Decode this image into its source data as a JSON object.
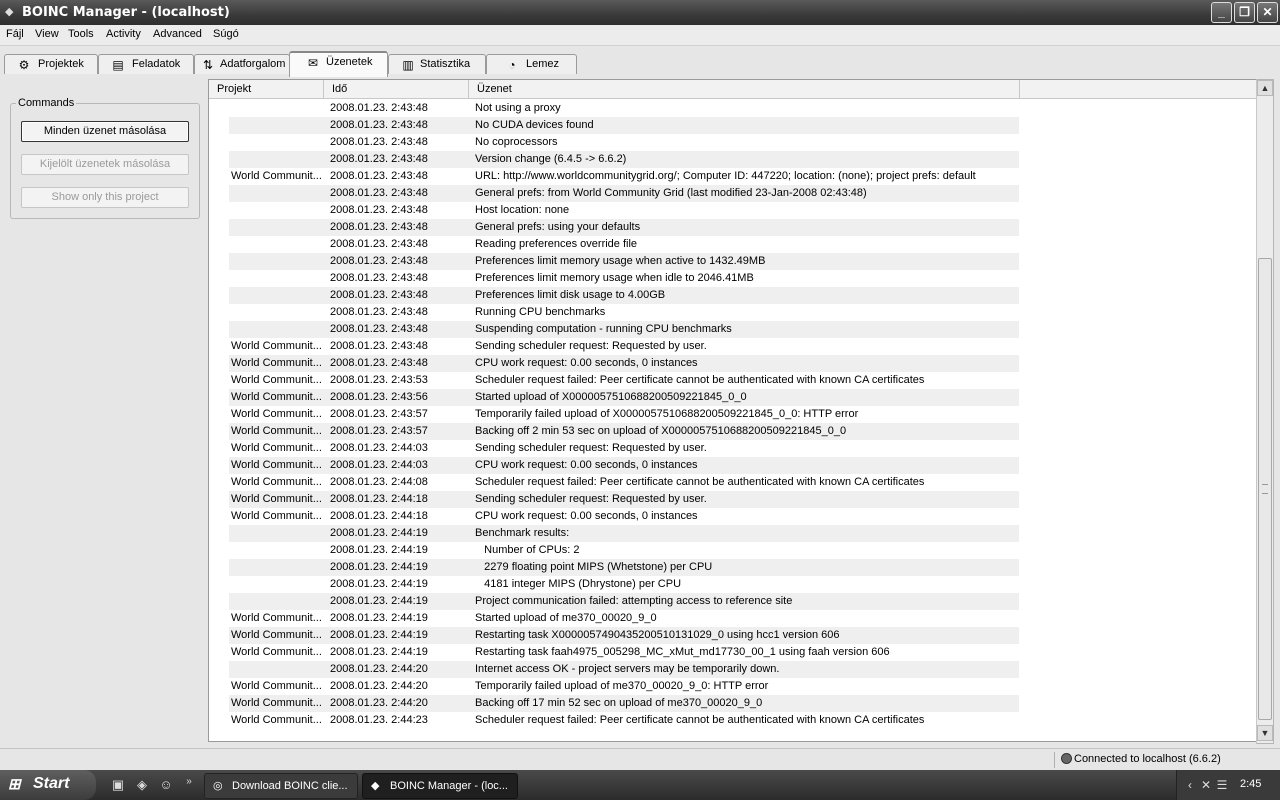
{
  "window": {
    "title": "BOINC Manager - (localhost)",
    "minimize": "_",
    "maximize": "❐",
    "close": "✕"
  },
  "menu": [
    "Fájl",
    "View",
    "Tools",
    "Activity",
    "Advanced",
    "Súgó"
  ],
  "tabs": [
    {
      "label": "Projektek",
      "icon": "gear-icon"
    },
    {
      "label": "Feladatok",
      "icon": "document-icon"
    },
    {
      "label": "Adatforgalom",
      "icon": "transfer-icon"
    },
    {
      "label": "Üzenetek",
      "icon": "envelope-icon",
      "active": true
    },
    {
      "label": "Statisztika",
      "icon": "bar-chart-icon"
    },
    {
      "label": "Lemez",
      "icon": "disk-icon"
    }
  ],
  "commands": {
    "title": "Commands",
    "copy_all": "Minden üzenet másolása",
    "copy_selected": "Kijelölt üzenetek másolása",
    "show_project": "Show only this project"
  },
  "columns": {
    "project": "Projekt",
    "time": "Idő",
    "message": "Üzenet"
  },
  "messages": [
    {
      "project": "",
      "time": "2008.01.23. 2:43:48",
      "msg": "Not using a proxy"
    },
    {
      "project": "",
      "time": "2008.01.23. 2:43:48",
      "msg": "No CUDA devices found"
    },
    {
      "project": "",
      "time": "2008.01.23. 2:43:48",
      "msg": "No coprocessors"
    },
    {
      "project": "",
      "time": "2008.01.23. 2:43:48",
      "msg": "Version change (6.4.5 -> 6.6.2)"
    },
    {
      "project": "World Communit...",
      "time": "2008.01.23. 2:43:48",
      "msg": "URL: http://www.worldcommunitygrid.org/; Computer ID: 447220; location: (none); project prefs: default"
    },
    {
      "project": "",
      "time": "2008.01.23. 2:43:48",
      "msg": "General prefs: from World Community Grid (last modified 23-Jan-2008 02:43:48)"
    },
    {
      "project": "",
      "time": "2008.01.23. 2:43:48",
      "msg": "Host location: none"
    },
    {
      "project": "",
      "time": "2008.01.23. 2:43:48",
      "msg": "General prefs: using your defaults"
    },
    {
      "project": "",
      "time": "2008.01.23. 2:43:48",
      "msg": "Reading preferences override file"
    },
    {
      "project": "",
      "time": "2008.01.23. 2:43:48",
      "msg": "Preferences limit memory usage when active to 1432.49MB"
    },
    {
      "project": "",
      "time": "2008.01.23. 2:43:48",
      "msg": "Preferences limit memory usage when idle to 2046.41MB"
    },
    {
      "project": "",
      "time": "2008.01.23. 2:43:48",
      "msg": "Preferences limit disk usage to 4.00GB"
    },
    {
      "project": "",
      "time": "2008.01.23. 2:43:48",
      "msg": "Running CPU benchmarks"
    },
    {
      "project": "",
      "time": "2008.01.23. 2:43:48",
      "msg": "Suspending computation - running CPU benchmarks"
    },
    {
      "project": "World Communit...",
      "time": "2008.01.23. 2:43:48",
      "msg": "Sending scheduler request: Requested by user."
    },
    {
      "project": "World Communit...",
      "time": "2008.01.23. 2:43:48",
      "msg": "CPU work request: 0.00 seconds, 0 instances"
    },
    {
      "project": "World Communit...",
      "time": "2008.01.23. 2:43:53",
      "msg": "Scheduler request failed: Peer certificate cannot be authenticated with known CA certificates"
    },
    {
      "project": "World Communit...",
      "time": "2008.01.23. 2:43:56",
      "msg": "Started upload of X0000057510688200509221845_0_0"
    },
    {
      "project": "World Communit...",
      "time": "2008.01.23. 2:43:57",
      "msg": "Temporarily failed upload of X0000057510688200509221845_0_0: HTTP error"
    },
    {
      "project": "World Communit...",
      "time": "2008.01.23. 2:43:57",
      "msg": "Backing off 2 min 53 sec on upload of X0000057510688200509221845_0_0"
    },
    {
      "project": "World Communit...",
      "time": "2008.01.23. 2:44:03",
      "msg": "Sending scheduler request: Requested by user."
    },
    {
      "project": "World Communit...",
      "time": "2008.01.23. 2:44:03",
      "msg": "CPU work request: 0.00 seconds, 0 instances"
    },
    {
      "project": "World Communit...",
      "time": "2008.01.23. 2:44:08",
      "msg": "Scheduler request failed: Peer certificate cannot be authenticated with known CA certificates"
    },
    {
      "project": "World Communit...",
      "time": "2008.01.23. 2:44:18",
      "msg": "Sending scheduler request: Requested by user."
    },
    {
      "project": "World Communit...",
      "time": "2008.01.23. 2:44:18",
      "msg": "CPU work request: 0.00 seconds, 0 instances"
    },
    {
      "project": "",
      "time": "2008.01.23. 2:44:19",
      "msg": "Benchmark results:"
    },
    {
      "project": "",
      "time": "2008.01.23. 2:44:19",
      "msg": "   Number of CPUs: 2"
    },
    {
      "project": "",
      "time": "2008.01.23. 2:44:19",
      "msg": "   2279 floating point MIPS (Whetstone) per CPU"
    },
    {
      "project": "",
      "time": "2008.01.23. 2:44:19",
      "msg": "   4181 integer MIPS (Dhrystone) per CPU"
    },
    {
      "project": "",
      "time": "2008.01.23. 2:44:19",
      "msg": "Project communication failed: attempting access to reference site"
    },
    {
      "project": "World Communit...",
      "time": "2008.01.23. 2:44:19",
      "msg": "Started upload of me370_00020_9_0"
    },
    {
      "project": "World Communit...",
      "time": "2008.01.23. 2:44:19",
      "msg": "Restarting task X0000057490435200510131029_0 using hcc1 version 606"
    },
    {
      "project": "World Communit...",
      "time": "2008.01.23. 2:44:19",
      "msg": "Restarting task faah4975_005298_MC_xMut_md17730_00_1 using faah version 606"
    },
    {
      "project": "",
      "time": "2008.01.23. 2:44:20",
      "msg": "Internet access OK - project servers may be temporarily down."
    },
    {
      "project": "World Communit...",
      "time": "2008.01.23. 2:44:20",
      "msg": "Temporarily failed upload of me370_00020_9_0: HTTP error"
    },
    {
      "project": "World Communit...",
      "time": "2008.01.23. 2:44:20",
      "msg": "Backing off 17 min 52 sec on upload of me370_00020_9_0"
    },
    {
      "project": "World Communit...",
      "time": "2008.01.23. 2:44:23",
      "msg": "Scheduler request failed: Peer certificate cannot be authenticated with known CA certificates"
    }
  ],
  "status": {
    "connection": "Connected to localhost (6.6.2)"
  },
  "taskbar": {
    "start": "Start",
    "tasks": [
      {
        "label": "Download BOINC clie...",
        "icon": "browser-icon"
      },
      {
        "label": "BOINC Manager - (loc...",
        "icon": "boinc-icon",
        "active": true
      }
    ],
    "clock": "2:45"
  }
}
